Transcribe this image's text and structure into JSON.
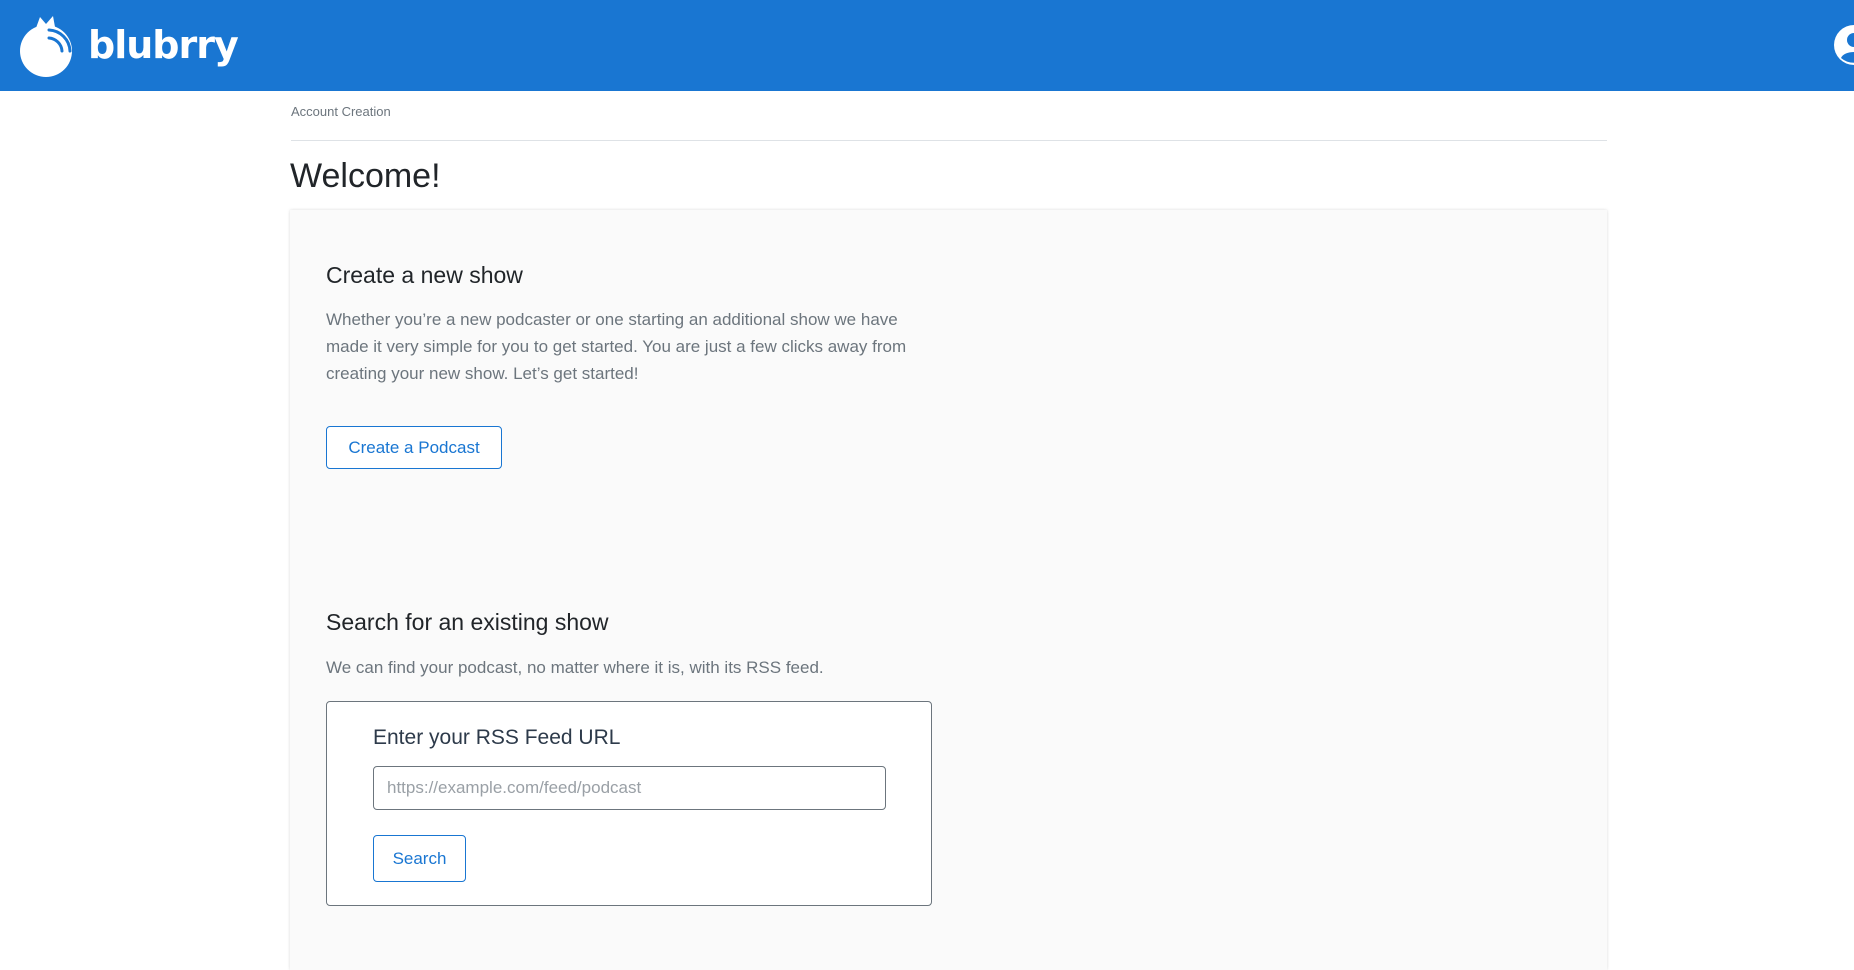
{
  "header": {
    "logo_text": "blubrry",
    "brand_color": "#1976d2",
    "user_icon": "user-account-icon"
  },
  "breadcrumb": "Account Creation",
  "page_title": "Welcome!",
  "create_section": {
    "heading": "Create a new show",
    "description": "Whether you’re a new podcaster or one starting an additional show we have made it very simple for you to get started. You are just a few clicks away from creating your new show. Let’s get started!",
    "button_label": "Create a Podcast"
  },
  "search_section": {
    "heading": "Search for an existing show",
    "description": "We can find your podcast, no matter where it is, with its RSS feed.",
    "rss_label": "Enter your RSS Feed URL",
    "rss_value": "",
    "rss_placeholder": "https://example.com/feed/podcast",
    "button_label": "Search"
  }
}
